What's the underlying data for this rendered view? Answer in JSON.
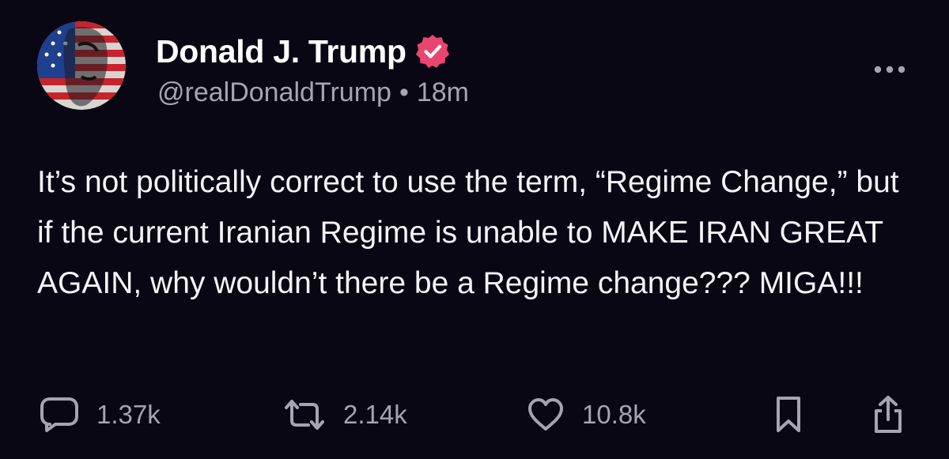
{
  "author": {
    "display_name": "Donald J. Trump",
    "handle": "@realDonaldTrump",
    "separator": "•",
    "timestamp": "18m",
    "verified": true,
    "verified_color": "#e8466f"
  },
  "post": {
    "text": "It’s not politically correct to use the term, “Regime Change,” but if the current Iranian Regime is unable to MAKE IRAN GREAT AGAIN, why wouldn’t there be a Regime change??? MIGA!!!"
  },
  "actions": {
    "reply": {
      "icon": "comment-icon",
      "count": "1.37k"
    },
    "repost": {
      "icon": "repost-icon",
      "count": "2.14k"
    },
    "like": {
      "icon": "heart-icon",
      "count": "10.8k"
    },
    "bookmark": {
      "icon": "bookmark-icon"
    },
    "share": {
      "icon": "share-icon"
    }
  },
  "colors": {
    "background": "#0a0715",
    "text": "#f4f3f7",
    "muted": "#a6a3b2"
  }
}
